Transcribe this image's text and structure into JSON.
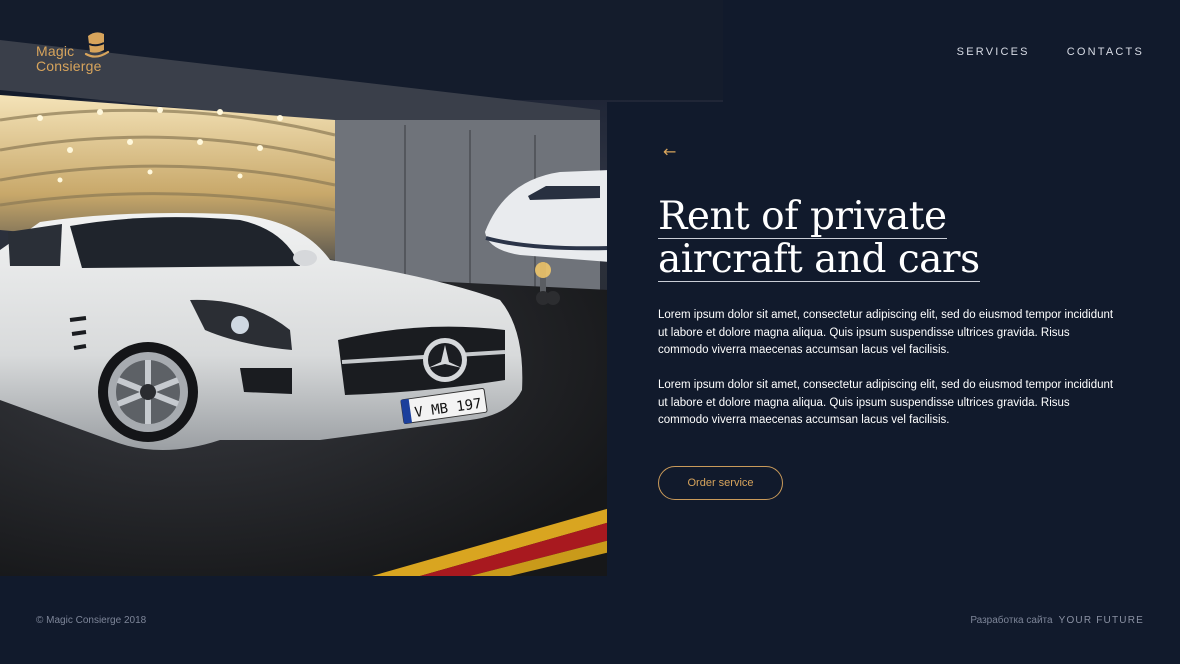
{
  "brand": {
    "logo_line1": "Magic",
    "logo_line2": "Consierge",
    "accent_color": "#d7a45c"
  },
  "nav": {
    "items": [
      {
        "label": "SERVICES"
      },
      {
        "label": "CONTACTS"
      }
    ]
  },
  "hero": {
    "plate_text": "V MB 197"
  },
  "main": {
    "back_icon": "←",
    "title_line1": "Rent of private",
    "title_line2": "aircraft and cars",
    "paragraphs": [
      "Lorem ipsum dolor sit amet, consectetur adipiscing elit, sed do eiusmod tempor incididunt ut labore et dolore magna aliqua. Quis ipsum suspendisse ultrices gravida. Risus commodo viverra maecenas accumsan lacus vel facilisis.",
      "Lorem ipsum dolor sit amet, consectetur adipiscing elit, sed do eiusmod tempor incididunt ut labore et dolore magna aliqua. Quis ipsum suspendisse ultrices gravida. Risus commodo viverra maecenas accumsan lacus vel facilisis."
    ],
    "cta_label": "Order service"
  },
  "footer": {
    "copyright": "© Magic Consierge  2018",
    "dev_label": "Разработка сайта",
    "dev_brand": "YOUR FUTURE"
  },
  "icons": {
    "logo": "top-hat-icon",
    "back": "arrow-left-icon"
  },
  "colors": {
    "background": "#111a2c",
    "text": "#ffffff",
    "muted": "#7d8598"
  }
}
